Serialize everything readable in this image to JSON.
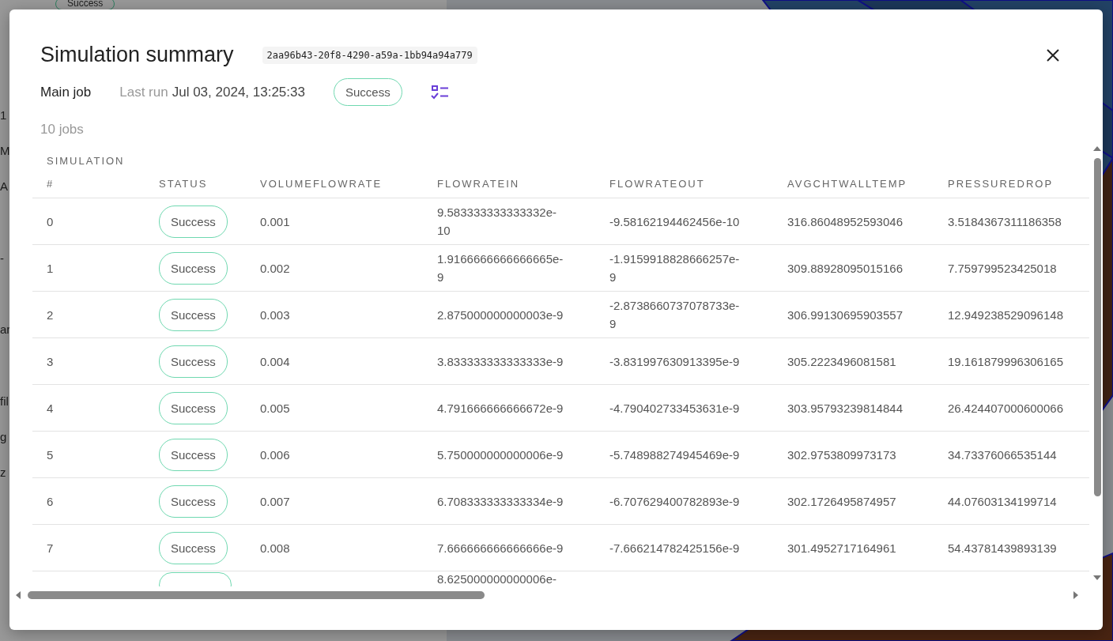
{
  "background": {
    "status_badge": "Success",
    "fragments": [
      "1",
      "M",
      "A",
      "-",
      "ar",
      "fil",
      "g",
      "z"
    ]
  },
  "dialog": {
    "title": "Simulation summary",
    "id": "2aa96b43-20f8-4290-a59a-1bb94a94a779",
    "job_label": "Main job",
    "last_run_label": "Last run",
    "last_run": "Jul 03, 2024, 13:25:33",
    "status": "Success",
    "job_count": "10 jobs"
  },
  "table": {
    "columns": [
      {
        "label": "SIMULATION",
        "sub": "#"
      },
      {
        "label": "STATUS"
      },
      {
        "label": "VOLUMEFLOWRATE"
      },
      {
        "label": "FLOWRATEIN"
      },
      {
        "label": "FLOWRATEOUT"
      },
      {
        "label": "AVGCHTWALLTEMP"
      },
      {
        "label": "PRESSUREDROP"
      }
    ],
    "rows": [
      {
        "cells": [
          "0",
          "Success",
          "0.001",
          "9.583333333333332e-10",
          "-9.58162194462456e-10",
          "316.86048952593046",
          "3.5184367311186358"
        ]
      },
      {
        "cells": [
          "1",
          "Success",
          "0.002",
          "1.9166666666666665e-9",
          "-1.9159918828666257e-9",
          "309.88928095015166",
          "7.759799523425018"
        ]
      },
      {
        "cells": [
          "2",
          "Success",
          "0.003",
          "2.875000000000003e-9",
          "-2.8738660737078733e-9",
          "306.99130695903557",
          "12.949238529096148"
        ]
      },
      {
        "cells": [
          "3",
          "Success",
          "0.004",
          "3.833333333333333e-9",
          "-3.831997630913395e-9",
          "305.2223496081581",
          "19.161879996306165"
        ]
      },
      {
        "cells": [
          "4",
          "Success",
          "0.005",
          "4.791666666666672e-9",
          "-4.790402733453631e-9",
          "303.95793239814844",
          "26.424407000600066"
        ]
      },
      {
        "cells": [
          "5",
          "Success",
          "0.006",
          "5.750000000000006e-9",
          "-5.748988274945469e-9",
          "302.9753809973173",
          "34.73376066535144"
        ]
      },
      {
        "cells": [
          "6",
          "Success",
          "0.007",
          "6.708333333333334e-9",
          "-6.707629400782893e-9",
          "302.1726495874957",
          "44.07603134199714"
        ]
      },
      {
        "cells": [
          "7",
          "Success",
          "0.008",
          "7.666666666666666e-9",
          "-7.666214782425156e-9",
          "301.4952717164961",
          "54.43781439893139"
        ]
      }
    ],
    "cut_row": {
      "flowratein": "8.625000000000006e-"
    }
  }
}
